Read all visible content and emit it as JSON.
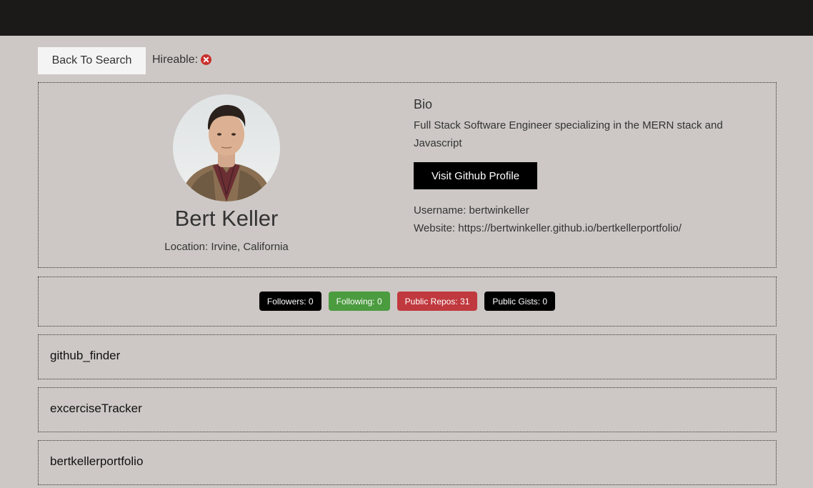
{
  "back_button_label": "Back To Search",
  "hireable": {
    "label": "Hireable:",
    "status": "not-hireable",
    "icon": "times-circle-icon",
    "icon_color": "#c9302c"
  },
  "profile": {
    "name": "Bert Keller",
    "location_label": "Location:",
    "location": "Irvine, California",
    "avatar_icon": "avatar-photo",
    "bio_heading": "Bio",
    "bio": "Full Stack Software Engineer specializing in the MERN stack and Javascript",
    "github_button_label": "Visit Github Profile",
    "username_label": "Username:",
    "username": "bertwinkeller",
    "website_label": "Website:",
    "website": "https://bertwinkeller.github.io/bertkellerportfolio/"
  },
  "stats": [
    {
      "label": "Followers: 0",
      "color": "#000000"
    },
    {
      "label": "Following: 0",
      "color": "#4b9b3f"
    },
    {
      "label": "Public Repos: 31",
      "color": "#c0393e"
    },
    {
      "label": "Public Gists: 0",
      "color": "#000000"
    }
  ],
  "repos": [
    {
      "name": "github_finder"
    },
    {
      "name": "excerciseTracker"
    },
    {
      "name": "bertkellerportfolio"
    }
  ]
}
